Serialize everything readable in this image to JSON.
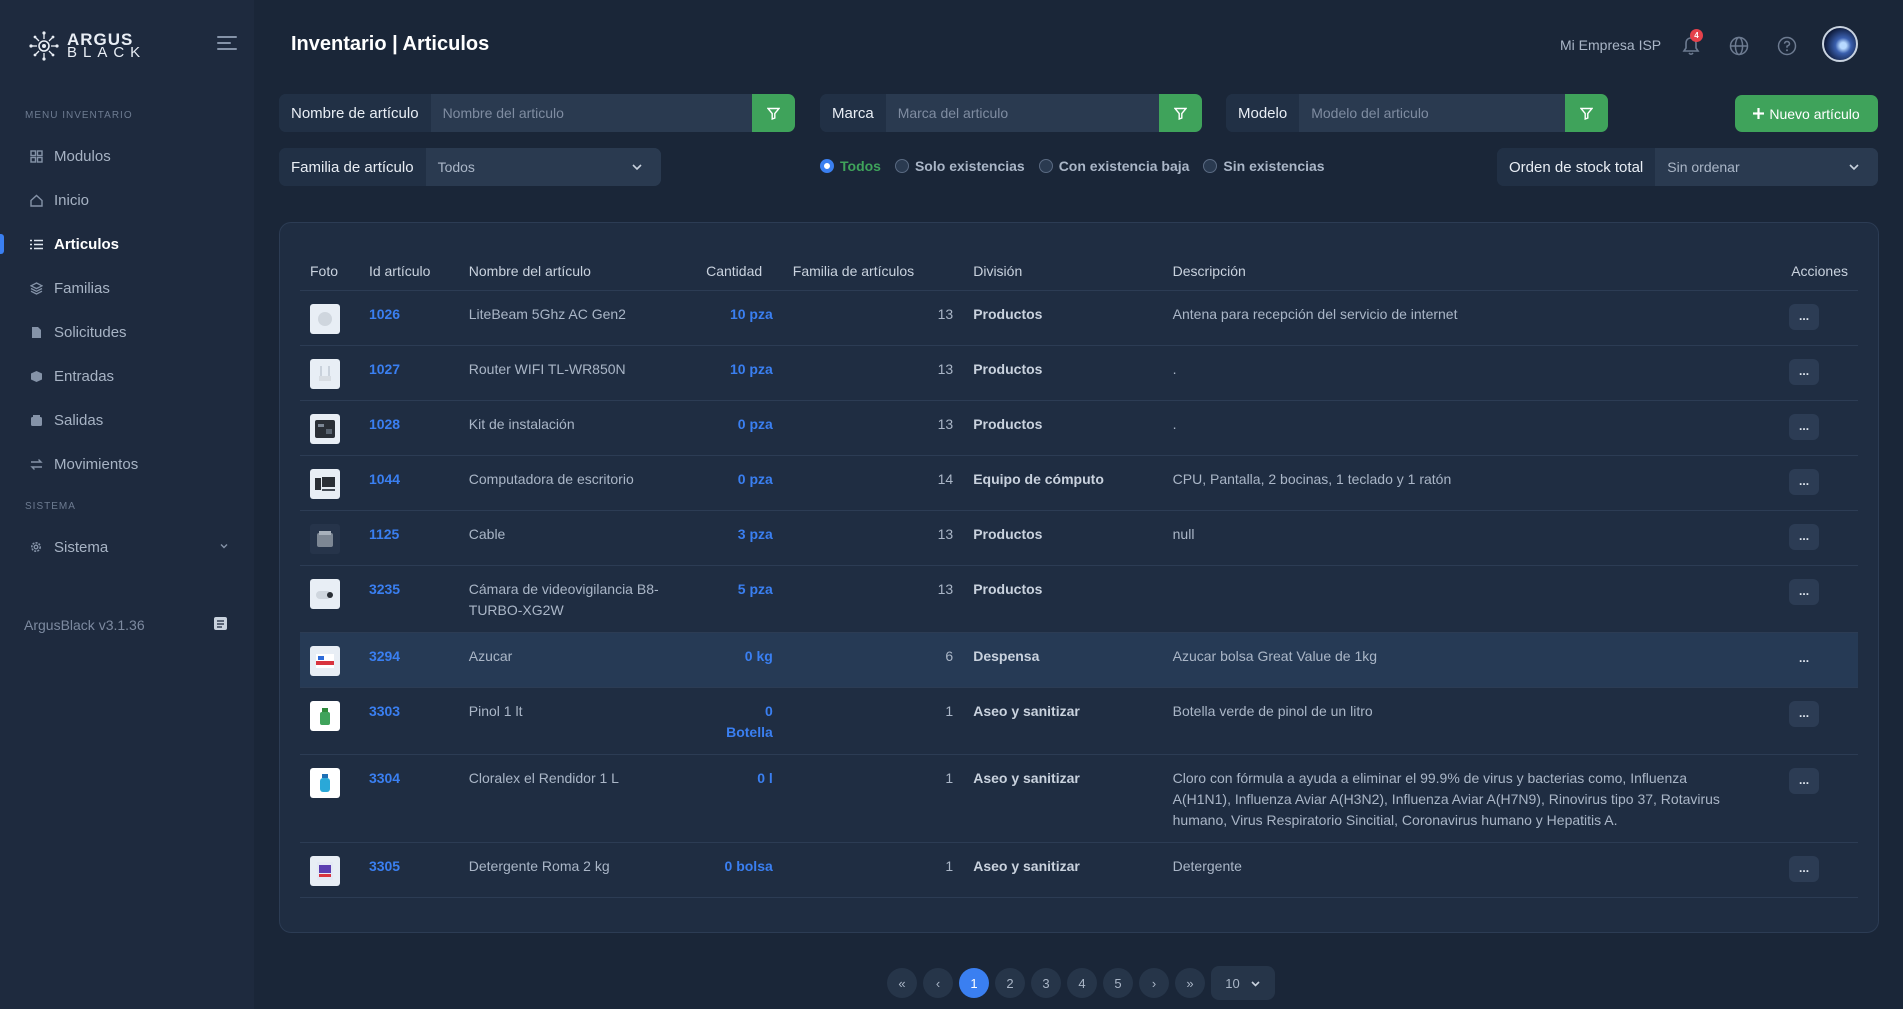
{
  "sidebar": {
    "logo_line1": "ARGUS",
    "logo_line2": "BLACK",
    "section_inventario": "MENU INVENTARIO",
    "section_sistema": "SISTEMA",
    "items": [
      {
        "label": "Modulos",
        "icon": "grid-icon"
      },
      {
        "label": "Inicio",
        "icon": "home-icon"
      },
      {
        "label": "Articulos",
        "icon": "list-icon"
      },
      {
        "label": "Familias",
        "icon": "layers-icon"
      },
      {
        "label": "Solicitudes",
        "icon": "document-icon"
      },
      {
        "label": "Entradas",
        "icon": "box-icon"
      },
      {
        "label": "Salidas",
        "icon": "box-out-icon"
      },
      {
        "label": "Movimientos",
        "icon": "swap-icon"
      }
    ],
    "sistema_item": "Sistema",
    "version": "ArgusBlack v3.1.36"
  },
  "header": {
    "title": "Inventario | Articulos",
    "company": "Mi Empresa ISP",
    "notifications": "4"
  },
  "filters": {
    "nombre_label": "Nombre de artículo",
    "nombre_placeholder": "Nombre del articulo",
    "marca_label": "Marca",
    "marca_placeholder": "Marca del articulo",
    "modelo_label": "Modelo",
    "modelo_placeholder": "Modelo del articulo",
    "familia_label": "Familia de artículo",
    "familia_value": "Todos",
    "orden_label": "Orden de stock total",
    "orden_value": "Sin ordenar",
    "new_button": "Nuevo artículo",
    "radios": [
      "Todos",
      "Solo existencias",
      "Con existencia baja",
      "Sin existencias"
    ],
    "radio_selected": "Todos"
  },
  "table": {
    "headers": [
      "Foto",
      "Id artículo",
      "Nombre del artículo",
      "Cantidad",
      "Familia de artículos",
      "División",
      "Descripción",
      "Acciones"
    ],
    "rows": [
      {
        "id": "1026",
        "name": "LiteBeam 5Ghz AC Gen2",
        "qty": "10 pza",
        "fam": "13",
        "div": "Productos",
        "desc": "Antena para recepción del servicio de internet",
        "action": "..."
      },
      {
        "id": "1027",
        "name": "Router WIFI TL-WR850N",
        "qty": "10 pza",
        "fam": "13",
        "div": "Productos",
        "desc": ".",
        "action": "..."
      },
      {
        "id": "1028",
        "name": "Kit de instalación",
        "qty": "0 pza",
        "fam": "13",
        "div": "Productos",
        "desc": ".",
        "action": "..."
      },
      {
        "id": "1044",
        "name": "Computadora de escritorio",
        "qty": "0 pza",
        "fam": "14",
        "div": "Equipo de cómputo",
        "desc": "CPU, Pantalla, 2 bocinas, 1 teclado y 1 ratón",
        "action": "..."
      },
      {
        "id": "1125",
        "name": "Cable",
        "qty": "3 pza",
        "fam": "13",
        "div": "Productos",
        "desc": "null",
        "action": "..."
      },
      {
        "id": "3235",
        "name": "Cámara de videovigilancia B8-TURBO-XG2W",
        "qty": "5 pza",
        "fam": "13",
        "div": "Productos",
        "desc": "",
        "action": "..."
      },
      {
        "id": "3294",
        "name": "Azucar",
        "qty": "0 kg",
        "fam": "6",
        "div": "Despensa",
        "desc": "Azucar bolsa Great Value de 1kg",
        "action": "..."
      },
      {
        "id": "3303",
        "name": "Pinol 1 lt",
        "qty": "0 Botella",
        "fam": "1",
        "div": "Aseo y sanitizar",
        "desc": "Botella verde de pinol de un litro",
        "action": "..."
      },
      {
        "id": "3304",
        "name": "Cloralex el Rendidor 1 L",
        "qty": "0 l",
        "fam": "1",
        "div": "Aseo y sanitizar",
        "desc": "Cloro con fórmula a ayuda a eliminar el 99.9% de virus y bacterias como, Influenza A(H1N1), Influenza Aviar A(H3N2), Influenza Aviar A(H7N9), Rinovirus tipo 37, Rotavirus humano, Virus Respiratorio Sincitial, Coronavirus humano y Hepatitis A.",
        "action": "..."
      },
      {
        "id": "3305",
        "name": "Detergente Roma 2 kg",
        "qty": "0 bolsa",
        "fam": "1",
        "div": "Aseo y sanitizar",
        "desc": "Detergente",
        "action": "..."
      }
    ]
  },
  "pager": {
    "first": "«",
    "prev": "‹",
    "pages": [
      "1",
      "2",
      "3",
      "4",
      "5"
    ],
    "current": "1",
    "next": "›",
    "last": "»",
    "page_size": "10"
  },
  "colors": {
    "accent": "#3a7ff1",
    "success": "#3fa35b",
    "bg": "#1a2638",
    "danger": "#e5414b"
  }
}
